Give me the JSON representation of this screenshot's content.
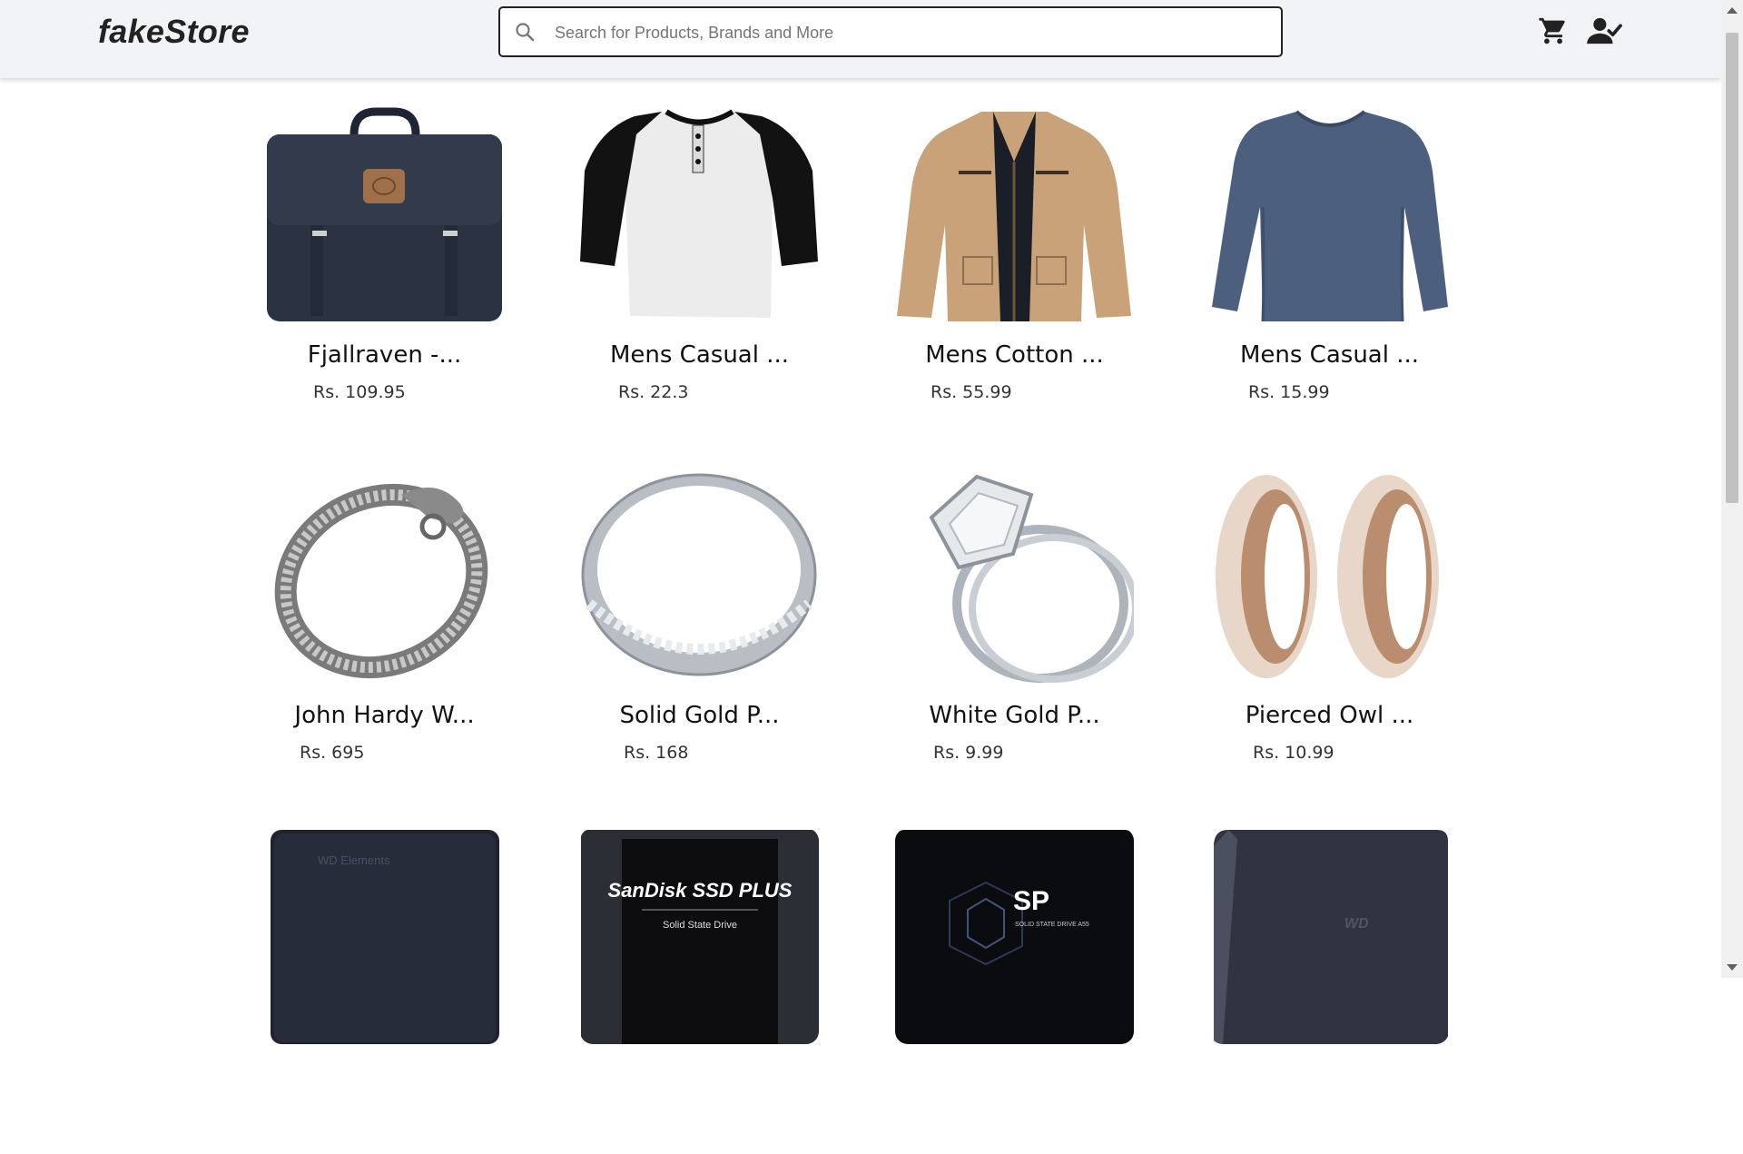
{
  "header": {
    "logo": "fakeStore",
    "search": {
      "placeholder": "Search for Products, Brands and More",
      "value": ""
    },
    "icons": [
      "search-icon",
      "cart-icon",
      "user-check-icon"
    ]
  },
  "products": [
    {
      "title": "Fjallraven -...",
      "price": "Rs. 109.95",
      "image": "backpack"
    },
    {
      "title": "Mens Casual ...",
      "price": "Rs. 22.3",
      "image": "raglan-tshirt"
    },
    {
      "title": "Mens Cotton ...",
      "price": "Rs. 55.99",
      "image": "cotton-jacket"
    },
    {
      "title": "Mens Casual ...",
      "price": "Rs. 15.99",
      "image": "slim-fit-tshirt"
    },
    {
      "title": "John Hardy W...",
      "price": "Rs. 695",
      "image": "dragon-bracelet"
    },
    {
      "title": "Solid Gold P...",
      "price": "Rs. 168",
      "image": "silver-ring"
    },
    {
      "title": "White Gold P...",
      "price": "Rs. 9.99",
      "image": "diamond-ring"
    },
    {
      "title": "Pierced Owl ...",
      "price": "Rs. 10.99",
      "image": "ear-tunnel-plugs"
    },
    {
      "title": "",
      "price": "",
      "image": "wd-external-drive",
      "label": "WD Elements"
    },
    {
      "title": "",
      "price": "",
      "image": "sandisk-ssd",
      "label": "SanDisk SSD PLUS",
      "sublabel": "Solid State Drive"
    },
    {
      "title": "",
      "price": "",
      "image": "silicon-power-ssd",
      "label": "SP",
      "sublabel": "SOLID STATE DRIVE A55"
    },
    {
      "title": "",
      "price": "",
      "image": "wd-gaming-drive",
      "label": "WD"
    }
  ],
  "colors": {
    "header_bg": "#f1f3f6",
    "text": "#111111",
    "price": "#333333"
  }
}
